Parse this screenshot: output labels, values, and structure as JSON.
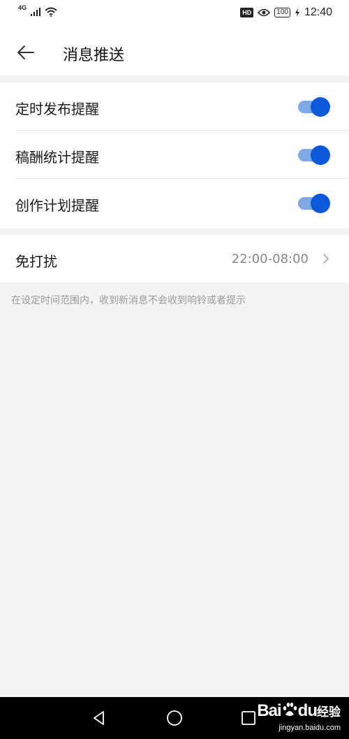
{
  "status_bar": {
    "network_label": "4G",
    "hd_label": "HD",
    "battery_level": "100",
    "time": "12:40"
  },
  "header": {
    "title": "消息推送",
    "back_icon": "arrow-left-icon"
  },
  "settings": {
    "items": [
      {
        "label": "定时发布提醒",
        "enabled": true
      },
      {
        "label": "稿酬统计提醒",
        "enabled": true
      },
      {
        "label": "创作计划提醒",
        "enabled": true
      }
    ],
    "toggle_color": "#0a59db",
    "track_color": "#7ea8e6"
  },
  "do_not_disturb": {
    "label": "免打扰",
    "value": "22:00-08:00",
    "hint": "在设定时间范围内，收到新消息不会收到响铃或者提示"
  },
  "nav_bar": {
    "icons": [
      "back-triangle-icon",
      "home-circle-icon",
      "recent-square-icon"
    ]
  },
  "watermark": {
    "brand_left": "Bai",
    "brand_right": "du",
    "brand_sub": "经验",
    "domain": "jingyan.baidu.com"
  }
}
